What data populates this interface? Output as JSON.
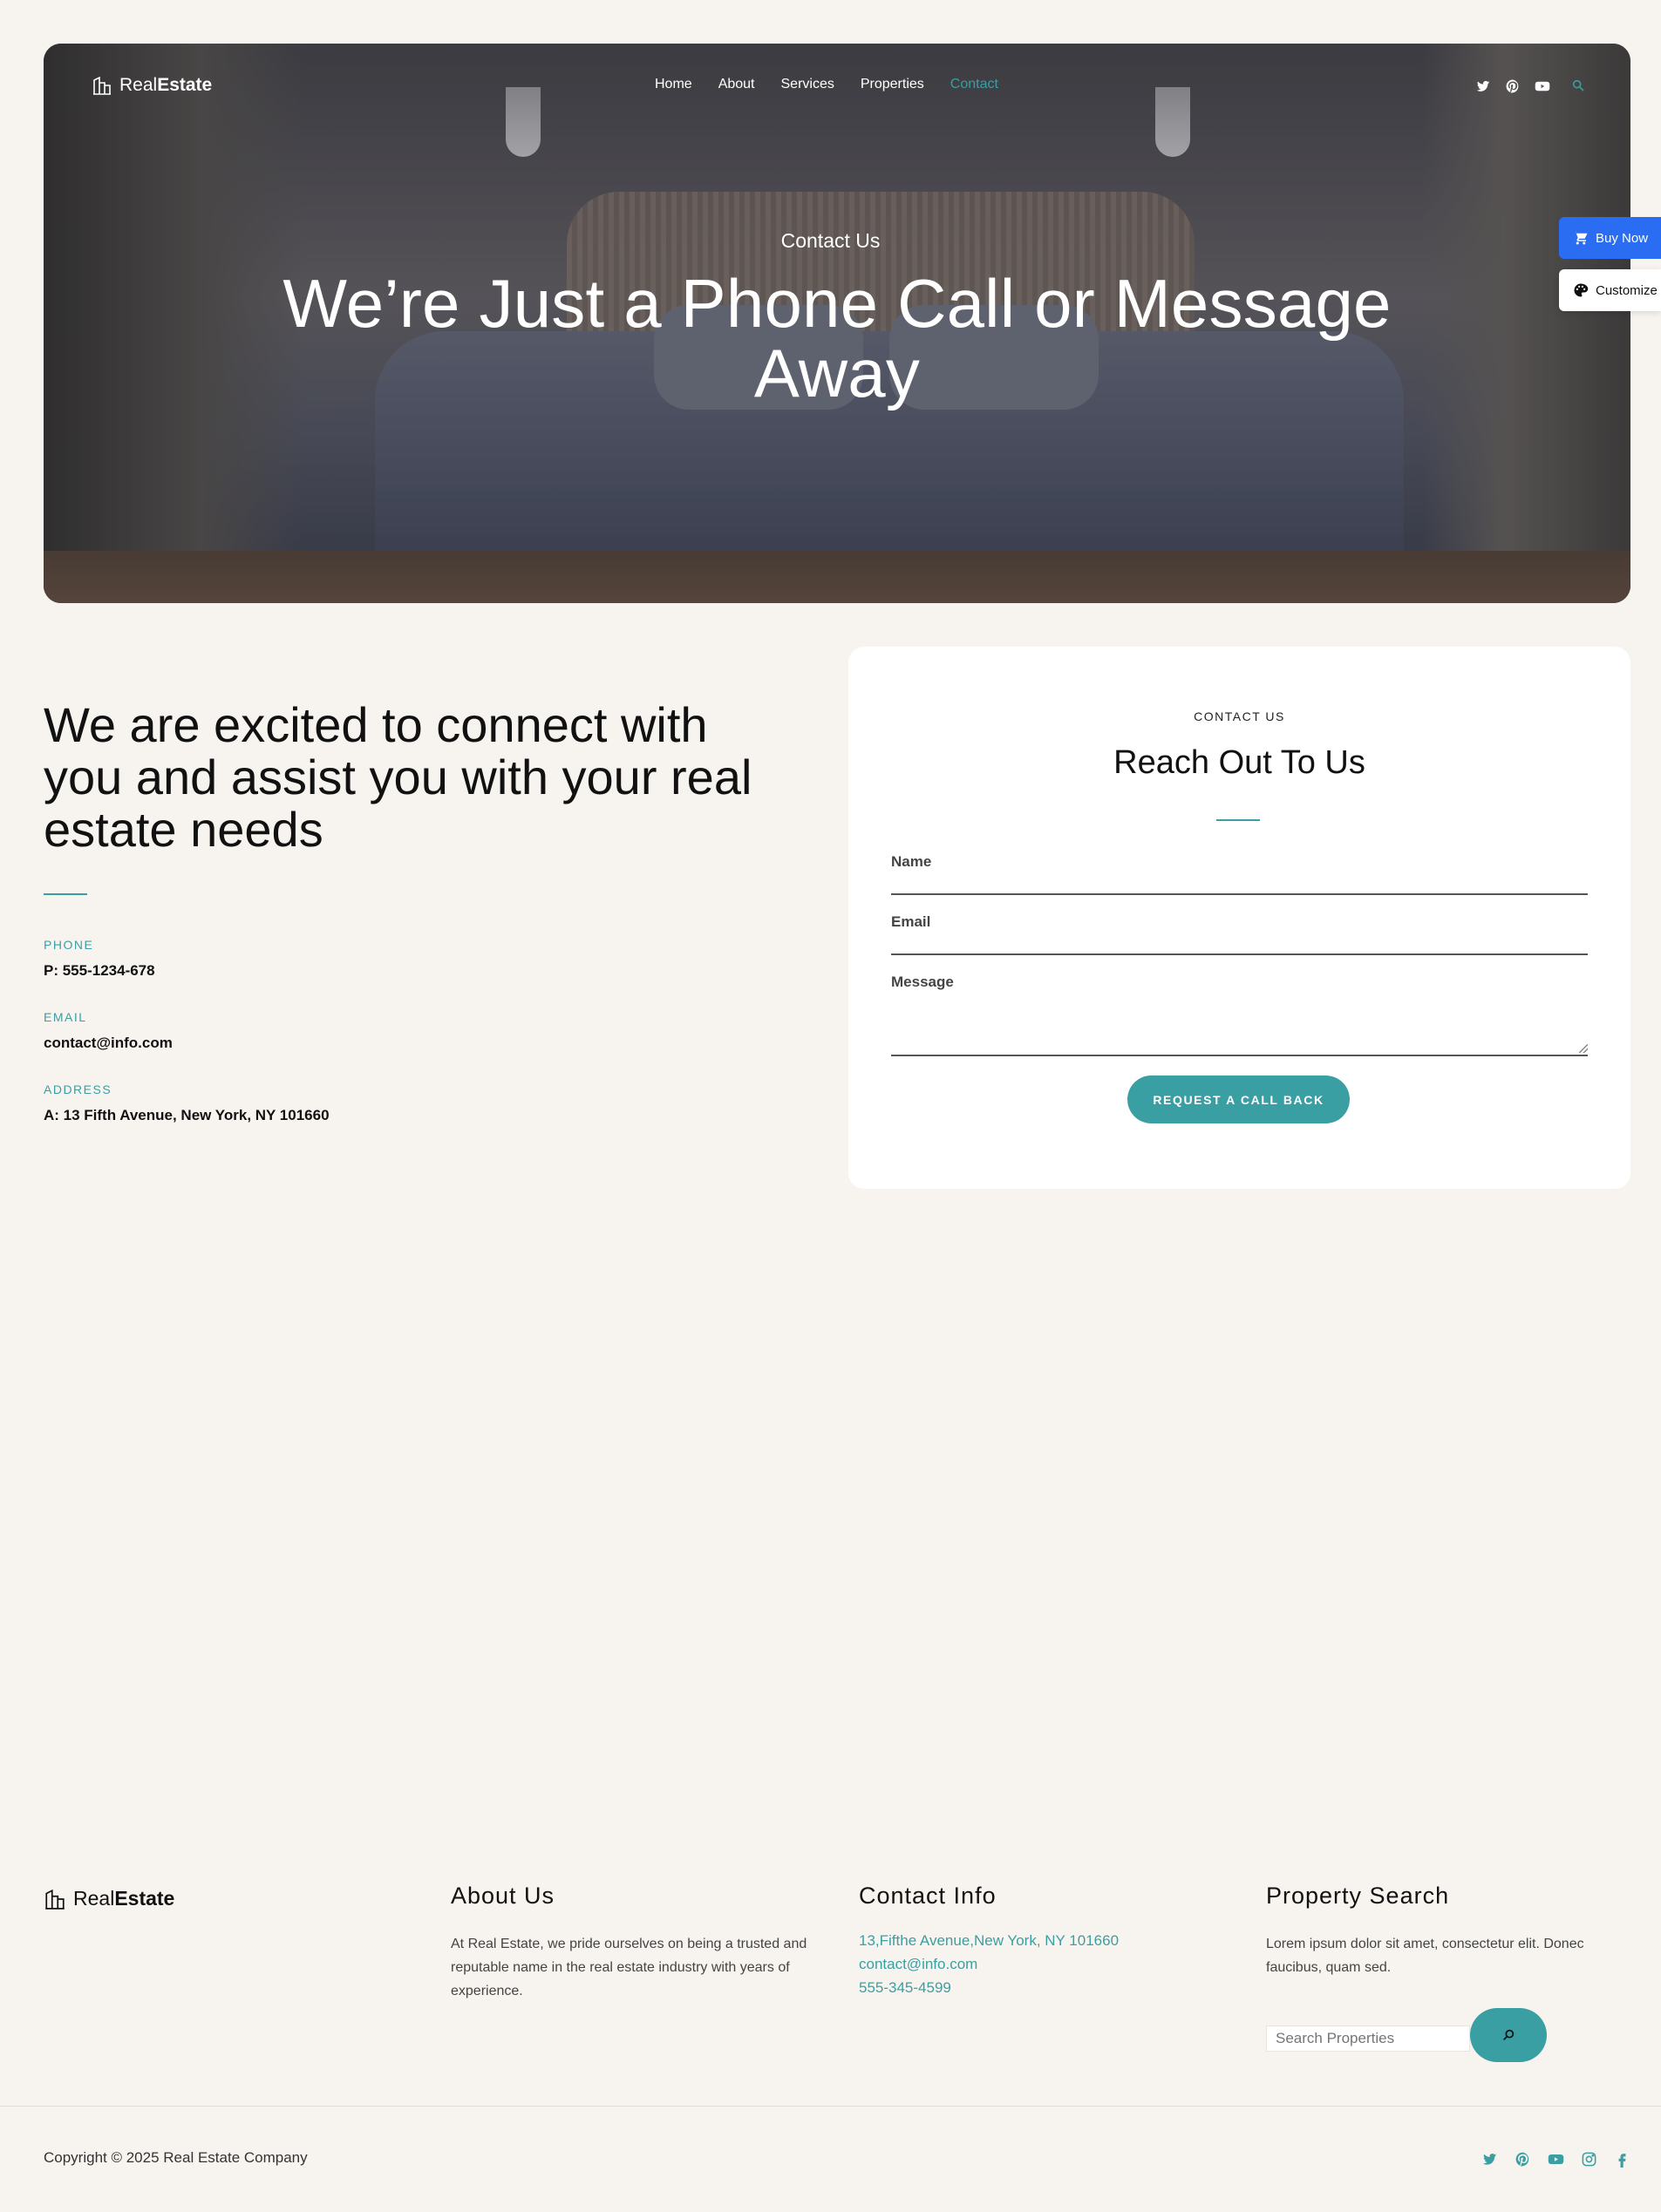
{
  "brand": {
    "light": "Real",
    "bold": "Estate"
  },
  "nav": [
    {
      "label": "Home"
    },
    {
      "label": "About"
    },
    {
      "label": "Services"
    },
    {
      "label": "Properties"
    },
    {
      "label": "Contact",
      "active": true
    }
  ],
  "social_icons": [
    "twitter-icon",
    "pinterest-icon",
    "youtube-icon"
  ],
  "hero": {
    "eyebrow": "Contact Us",
    "title": "We’re Just a Phone Call or Message Away"
  },
  "side_widgets": {
    "buy_now": "Buy Now",
    "customize": "Customize"
  },
  "intro": {
    "title": "We are excited to connect with you and assist you with your real estate needs"
  },
  "contact_info": {
    "phone_label": "PHONE",
    "phone_value": "P: 555-1234-678",
    "email_label": "EMAIL",
    "email_value": "contact@info.com",
    "address_label": "ADDRESS",
    "address_value": "A: 13 Fifth Avenue, New York, NY 101660"
  },
  "form": {
    "eyebrow": "CONTACT US",
    "title": "Reach Out To Us",
    "name_label": "Name",
    "email_label": "Email",
    "message_label": "Message",
    "submit_label": "REQUEST A CALL BACK"
  },
  "footer": {
    "about_title": "About Us",
    "about_text": "At Real Estate, we pride ourselves on being a trusted and reputable name in the real estate industry with years of experience.",
    "contact_title": "Contact Info",
    "contact_address": "13,Fifthe Avenue,New York, NY 101660",
    "contact_email": "contact@info.com",
    "contact_phone": "555-345-4599",
    "search_title": "Property Search",
    "search_text": "Lorem ipsum dolor sit amet, consectetur elit. Donec faucibus, quam sed.",
    "search_placeholder": "Search Properties",
    "copyright": "Copyright © 2025 Real Estate Company",
    "social_icons": [
      "twitter-icon",
      "pinterest-icon",
      "youtube-icon",
      "instagram-icon",
      "facebook-icon"
    ]
  },
  "colors": {
    "accent": "#3a9fa3",
    "page_bg": "#f7f4ef",
    "buy_now": "#2b6df2"
  }
}
